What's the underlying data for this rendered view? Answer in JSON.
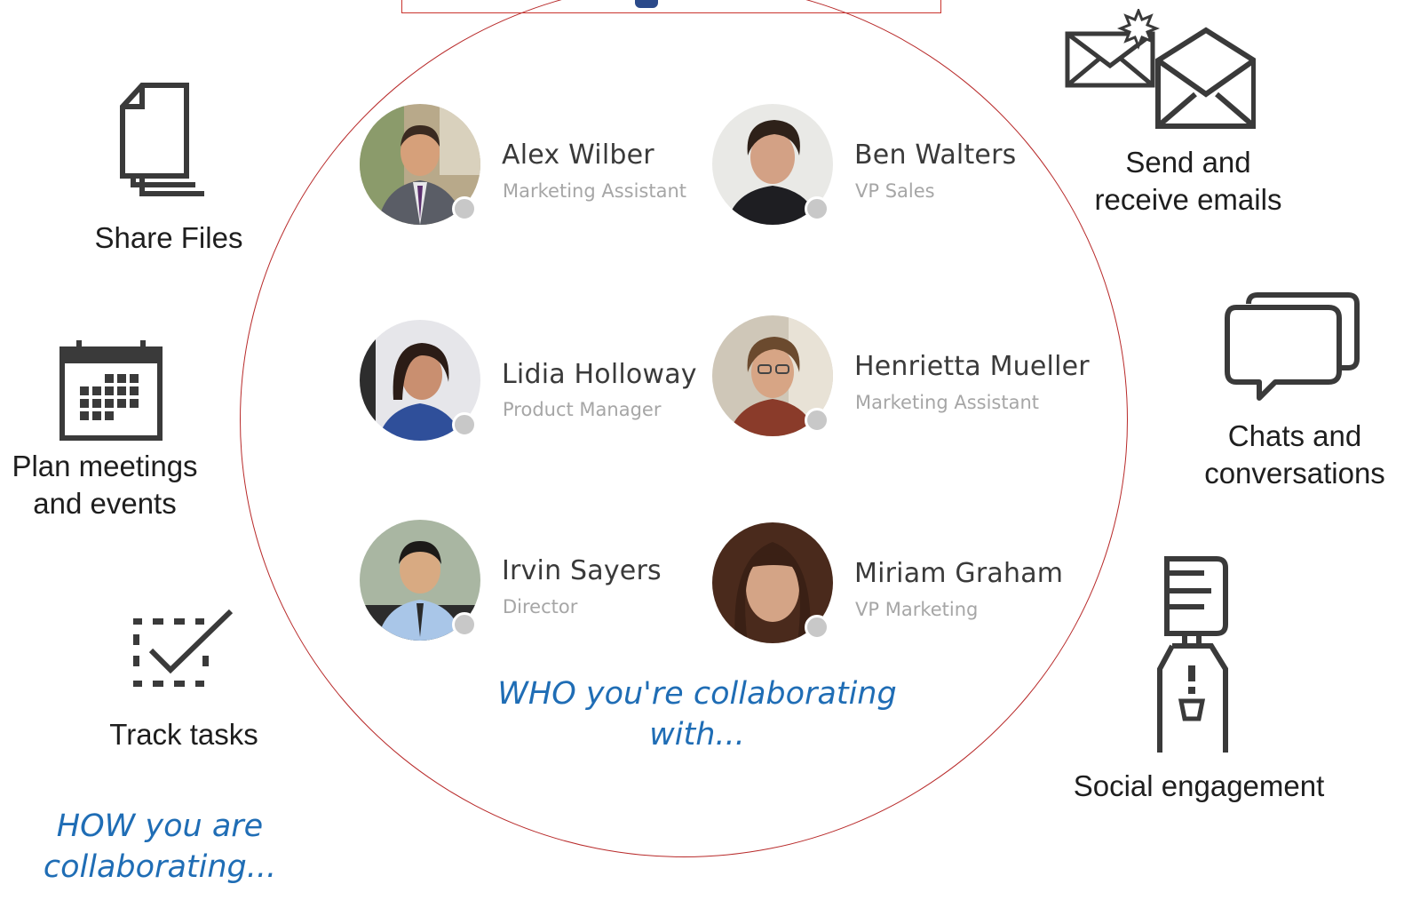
{
  "colors": {
    "circle": "#b82a2a",
    "title_border": "#c9342e",
    "caption_blue": "#1f6db5",
    "presence_dot": "#c8c8c8",
    "name_text": "#3a3a3a",
    "role_text": "#a6a6a6"
  },
  "people": [
    {
      "name": "Alex Wilber",
      "role": "Marketing Assistant"
    },
    {
      "name": "Ben Walters",
      "role": "VP Sales"
    },
    {
      "name": "Lidia Holloway",
      "role": "Product Manager"
    },
    {
      "name": "Henrietta Mueller",
      "role": "Marketing Assistant"
    },
    {
      "name": "Irvin Sayers",
      "role": "Director"
    },
    {
      "name": "Miriam Graham",
      "role": "VP Marketing"
    }
  ],
  "who_caption": "WHO you're collaborating with...",
  "how_caption": "HOW you are collaborating...",
  "activities": {
    "share_files": {
      "label": "Share Files",
      "icon": "documents-icon"
    },
    "plan_meetings": {
      "label_line1": "Plan meetings",
      "label_line2": "and events",
      "icon": "calendar-icon"
    },
    "track_tasks": {
      "label": "Track tasks",
      "icon": "task-checkbox-icon"
    },
    "emails": {
      "label_line1": "Send and",
      "label_line2": "receive emails",
      "icon": "envelopes-icon"
    },
    "chats": {
      "label_line1": "Chats and",
      "label_line2": "conversations",
      "icon": "chat-bubbles-icon"
    },
    "social": {
      "label": "Social engagement",
      "icon": "water-cooler-icon"
    }
  }
}
